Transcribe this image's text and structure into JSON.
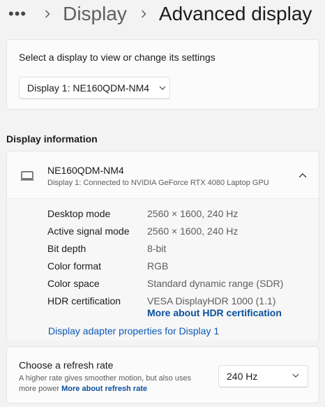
{
  "breadcrumb": {
    "more": "•••",
    "parent": "Display",
    "current": "Advanced display"
  },
  "display_select": {
    "prompt": "Select a display to view or change its settings",
    "selected": "Display 1: NE160QDM-NM4"
  },
  "display_info": {
    "section_title": "Display information",
    "monitor_name": "NE160QDM-NM4",
    "connection": "Display 1: Connected to NVIDIA GeForce RTX 4080 Laptop GPU",
    "expanded": true,
    "rows": [
      {
        "label": "Desktop mode",
        "value": "2560 × 1600, 240 Hz"
      },
      {
        "label": "Active signal mode",
        "value": "2560 × 1600, 240 Hz"
      },
      {
        "label": "Bit depth",
        "value": "8-bit"
      },
      {
        "label": "Color format",
        "value": "RGB"
      },
      {
        "label": "Color space",
        "value": "Standard dynamic range (SDR)"
      },
      {
        "label": "HDR certification",
        "value": "VESA DisplayHDR 1000 (1.1)"
      }
    ],
    "hdr_link": "More about HDR certification",
    "adapter_link": "Display adapter properties for Display 1"
  },
  "refresh_rate": {
    "title": "Choose a refresh rate",
    "description": "A higher rate gives smoother motion, but also uses more power",
    "link": "More about refresh rate",
    "selected": "240 Hz"
  },
  "colors": {
    "background": "#f3f3f3",
    "card": "#fbfbfb",
    "link": "#0b59b5",
    "secondary_text": "#5d5d5d"
  },
  "icons": [
    "more-icon",
    "chevron-right-icon",
    "chevron-down-icon",
    "chevron-up-icon",
    "monitor-icon"
  ]
}
